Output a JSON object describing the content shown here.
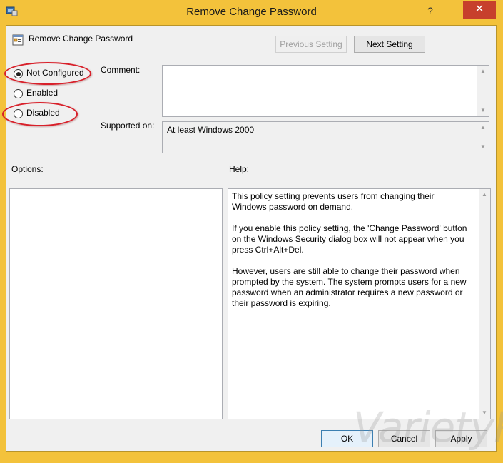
{
  "window": {
    "title": "Remove Change Password",
    "help_glyph": "?",
    "close_glyph": "✕"
  },
  "policy": {
    "name": "Remove Change Password"
  },
  "nav": {
    "previous_label": "Previous Setting",
    "next_label": "Next Setting"
  },
  "state": {
    "options": [
      {
        "label": "Not Configured",
        "checked": true
      },
      {
        "label": "Enabled",
        "checked": false
      },
      {
        "label": "Disabled",
        "checked": false
      }
    ]
  },
  "comment": {
    "label": "Comment:",
    "value": ""
  },
  "supported": {
    "label": "Supported on:",
    "value": "At least Windows 2000"
  },
  "options_panel": {
    "label": "Options:"
  },
  "help_panel": {
    "label": "Help:",
    "paragraphs": [
      "This policy setting prevents users from changing their Windows password on demand.",
      "If you enable this policy setting,  the 'Change Password' button on the Windows Security dialog box will not appear when you press Ctrl+Alt+Del.",
      "However, users are still able to change their password when prompted by the system. The system prompts users for a new password when an administrator requires a new password or their password is expiring."
    ]
  },
  "footer": {
    "ok_label": "OK",
    "cancel_label": "Cancel",
    "apply_label": "Apply"
  },
  "watermark": {
    "text": "VarietyPC"
  },
  "colors": {
    "title_bar": "#f3c23b",
    "close_button": "#c7402c",
    "highlight_ring": "#d8202a"
  },
  "icons": [
    "app-icon",
    "help-icon",
    "close-icon",
    "policy-icon",
    "scroll-up-icon",
    "scroll-down-icon"
  ]
}
